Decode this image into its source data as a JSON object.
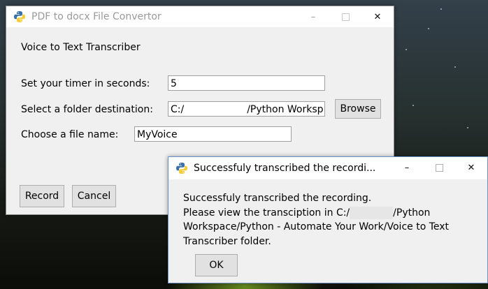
{
  "main_window": {
    "title": "PDF to docx File Convertor",
    "heading": "Voice to Text Transcriber",
    "timer_label": "Set your timer in seconds:",
    "timer_value": "5",
    "folder_label": "Select a folder destination:",
    "folder_value_prefix": "C:/",
    "folder_value_suffix": "/Python Worksp",
    "browse_label": "Browse",
    "filename_label": "Choose a file name:",
    "filename_value": "MyVoice",
    "record_label": "Record",
    "cancel_label": "Cancel"
  },
  "dialog": {
    "title": "Successfuly transcribed the recordi...",
    "line1": "Successfuly transcribed the recording.",
    "line2_prefix": "Please view the transciption in C:/",
    "line2_suffix": "/Python",
    "line3": "Workspace/Python - Automate Your Work/Voice to Text",
    "line4": "Transcriber folder.",
    "ok_label": "OK"
  },
  "window_controls": {
    "minimize": "–",
    "maximize": "□",
    "close": "✕"
  }
}
